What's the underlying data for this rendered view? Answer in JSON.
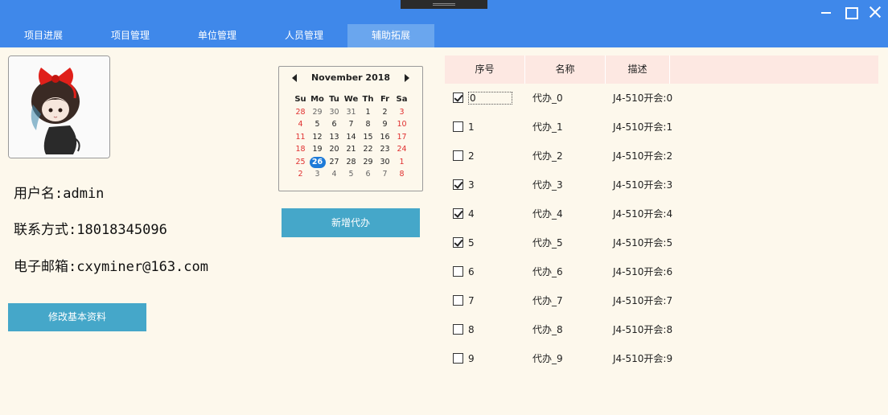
{
  "window": {
    "controls": {
      "minimize": "minimize-icon",
      "maximize": "maximize-icon",
      "close": "close-icon"
    }
  },
  "nav": {
    "tabs": [
      {
        "label": "项目进展"
      },
      {
        "label": "项目管理"
      },
      {
        "label": "单位管理"
      },
      {
        "label": "人员管理"
      },
      {
        "label": "辅助拓展",
        "active": true
      }
    ]
  },
  "profile": {
    "username": "用户名:admin",
    "contact": "联系方式:18018345096",
    "email": "电子邮箱:cxyminer@163.com",
    "edit_button": "修改基本资料"
  },
  "calendar": {
    "month_label": "November 2018",
    "weekdays": [
      "Su",
      "Mo",
      "Tu",
      "We",
      "Th",
      "Fr",
      "Sa"
    ],
    "weeks": [
      [
        "28",
        "29",
        "30",
        "31",
        "1",
        "2",
        "3"
      ],
      [
        "4",
        "5",
        "6",
        "7",
        "8",
        "9",
        "10"
      ],
      [
        "11",
        "12",
        "13",
        "14",
        "15",
        "16",
        "17"
      ],
      [
        "18",
        "19",
        "20",
        "21",
        "22",
        "23",
        "24"
      ],
      [
        "25",
        "26",
        "27",
        "28",
        "29",
        "30",
        "1"
      ],
      [
        "2",
        "3",
        "4",
        "5",
        "6",
        "7",
        "8"
      ]
    ],
    "selected": "26"
  },
  "add_todo_button": "新增代办",
  "table": {
    "headers": [
      "序号",
      "名称",
      "描述"
    ],
    "rows": [
      {
        "index": "0",
        "name": "代办_0",
        "desc": "J4-510开会:0",
        "checked": true
      },
      {
        "index": "1",
        "name": "代办_1",
        "desc": "J4-510开会:1",
        "checked": false
      },
      {
        "index": "2",
        "name": "代办_2",
        "desc": "J4-510开会:2",
        "checked": false
      },
      {
        "index": "3",
        "name": "代办_3",
        "desc": "J4-510开会:3",
        "checked": true
      },
      {
        "index": "4",
        "name": "代办_4",
        "desc": "J4-510开会:4",
        "checked": true
      },
      {
        "index": "5",
        "name": "代办_5",
        "desc": "J4-510开会:5",
        "checked": true
      },
      {
        "index": "6",
        "name": "代办_6",
        "desc": "J4-510开会:6",
        "checked": false
      },
      {
        "index": "7",
        "name": "代办_7",
        "desc": "J4-510开会:7",
        "checked": false
      },
      {
        "index": "8",
        "name": "代办_8",
        "desc": "J4-510开会:8",
        "checked": false
      },
      {
        "index": "9",
        "name": "代办_9",
        "desc": "J4-510开会:9",
        "checked": false
      }
    ]
  },
  "colors": {
    "header_bg": "#3f88ea",
    "active_tab": "#6aa6ee",
    "button": "#45a7c9",
    "page_bg": "#fdf8ec",
    "table_header": "#fde8e2"
  }
}
